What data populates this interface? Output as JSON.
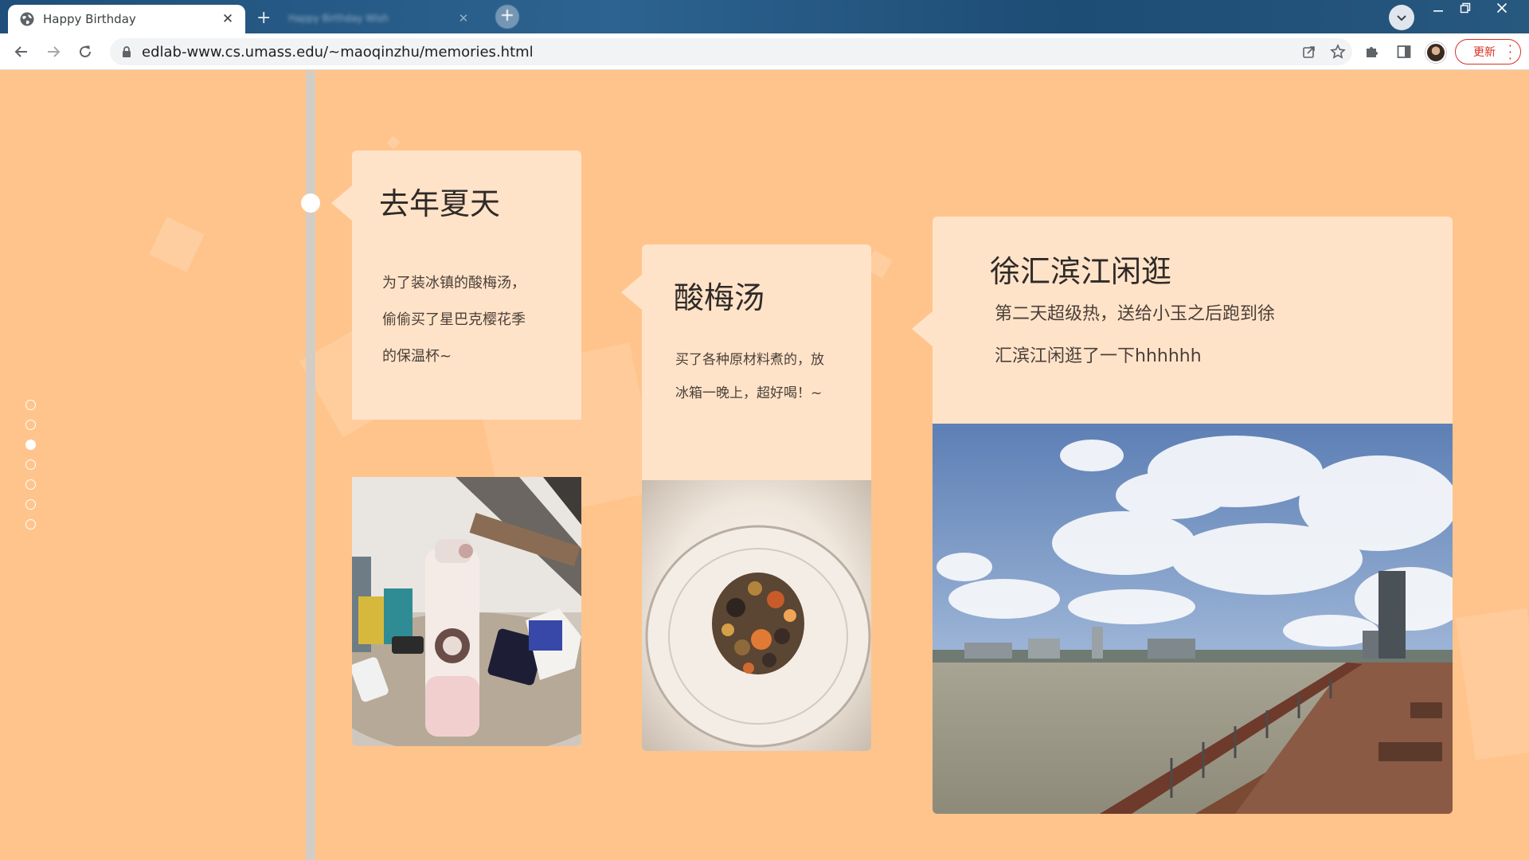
{
  "browser": {
    "active_tab_title": "Happy Birthday",
    "second_tab_title": "Happy Birthday Wish",
    "url": "edlab-www.cs.umass.edu/~maoqinzhu/memories.html",
    "update_label": "更新"
  },
  "colors": {
    "page_background": "#ffc48c",
    "card_background": "#ffe3c9",
    "timeline": "#d4cdc6",
    "update_accent": "#d93025"
  },
  "pager": {
    "dots": 7,
    "active_index": 2
  },
  "cards": [
    {
      "title": "去年夏天",
      "lines": [
        "为了装冰镇的酸梅汤，",
        "偷偷买了星巴克樱花季",
        "的保温杯~"
      ],
      "photo": "pink Starbucks thermos bottle on a table"
    },
    {
      "title": "酸梅汤",
      "lines": [
        "买了各种原材料煮的，放",
        "冰箱一晚上，超好喝！~"
      ],
      "photo": "glass bowl with dried plum soup ingredients"
    },
    {
      "title": "徐汇滨江闲逛",
      "lines": [
        "第二天超级热，送给小玉之后跑到徐",
        "汇滨江闲逛了一下hhhhhh"
      ],
      "photo": "riverside boardwalk under a cloudy blue sky"
    }
  ]
}
